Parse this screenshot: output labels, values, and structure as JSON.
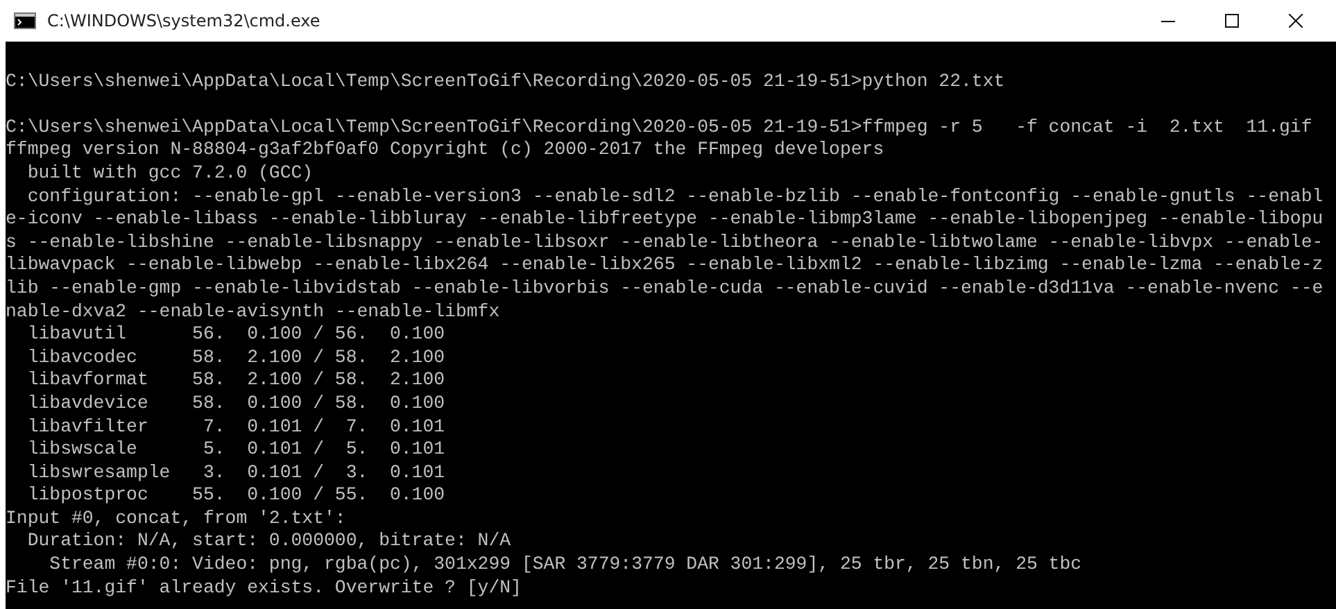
{
  "window": {
    "title": "C:\\WINDOWS\\system32\\cmd.exe"
  },
  "console": {
    "blocks": [
      {
        "lines": [
          "C:\\Users\\shenwei\\AppData\\Local\\Temp\\ScreenToGif\\Recording\\2020-05-05 21-19-51>python 22.txt"
        ]
      },
      {
        "lines": [
          "C:\\Users\\shenwei\\AppData\\Local\\Temp\\ScreenToGif\\Recording\\2020-05-05 21-19-51>ffmpeg -r 5   -f concat -i  2.txt  11.gif",
          "ffmpeg version N-88804-g3af2bf0af0 Copyright (c) 2000-2017 the FFmpeg developers",
          "  built with gcc 7.2.0 (GCC)",
          "  configuration: --enable-gpl --enable-version3 --enable-sdl2 --enable-bzlib --enable-fontconfig --enable-gnutls --enabl",
          "e-iconv --enable-libass --enable-libbluray --enable-libfreetype --enable-libmp3lame --enable-libopenjpeg --enable-libopu",
          "s --enable-libshine --enable-libsnappy --enable-libsoxr --enable-libtheora --enable-libtwolame --enable-libvpx --enable-",
          "libwavpack --enable-libwebp --enable-libx264 --enable-libx265 --enable-libxml2 --enable-libzimg --enable-lzma --enable-z",
          "lib --enable-gmp --enable-libvidstab --enable-libvorbis --enable-cuda --enable-cuvid --enable-d3d11va --enable-nvenc --e",
          "nable-dxva2 --enable-avisynth --enable-libmfx",
          "  libavutil      56.  0.100 / 56.  0.100",
          "  libavcodec     58.  2.100 / 58.  2.100",
          "  libavformat    58.  2.100 / 58.  2.100",
          "  libavdevice    58.  0.100 / 58.  0.100",
          "  libavfilter     7.  0.101 /  7.  0.101",
          "  libswscale      5.  0.101 /  5.  0.101",
          "  libswresample   3.  0.101 /  3.  0.101",
          "  libpostproc    55.  0.100 / 55.  0.100",
          "Input #0, concat, from '2.txt':",
          "  Duration: N/A, start: 0.000000, bitrate: N/A",
          "    Stream #0:0: Video: png, rgba(pc), 301x299 [SAR 3779:3779 DAR 301:299], 25 tbr, 25 tbn, 25 tbc",
          "File '11.gif' already exists. Overwrite ? [y/N]"
        ]
      }
    ]
  }
}
